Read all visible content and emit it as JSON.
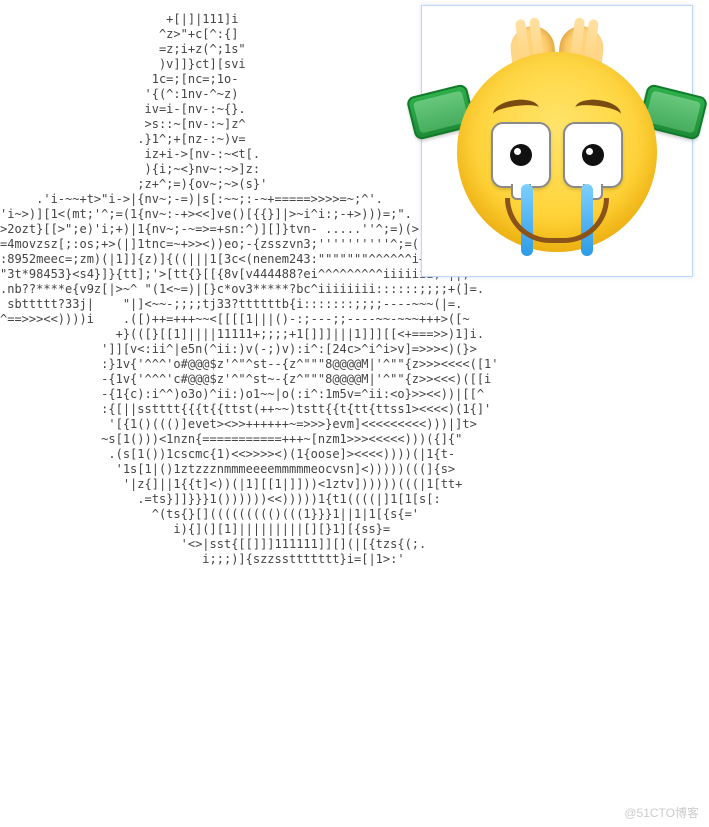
{
  "watermark": "@51CTO博客",
  "emoji": "praying-crying-face",
  "ascii": [
    "                       +[|]|111]i",
    "                      ^z>\"+c[^:{]",
    "                      =z;i+z(^;1s\"",
    "                      )v]]}ct][svi",
    "                     1c=;[nc=;1o-",
    "                    '{(^:1nv-^~z)",
    "                    iv=i-[nv-:~{}.",
    "                    >s::~[nv-:~]z^",
    "                   .}1^;+[nz-:~)v=",
    "                    iz+i->[nv-:~<t[.",
    "                    ){i;~<}nv~:~>]z:",
    "                   ;z+^;=){ov~;~>(s}'",
    "     .'i-~~+t>\"i->|{nv~;-=)|s[:~~;:-~+=====>>>>=~;^'.",
    "'i~>)][1<(mt;'^;=(1{nv~:-+><<]ve()[{{}]|>~i^i:;-+>)))=;\".",
    ">2ozt}[[>\";e)'i;+)|1{nv~;-~=>=+sn:^)][]}tvn- .....''^;=)(>;'",
    "=4movzsz[;:os;+>(|]1tnc=~+>><))eo;-{zsszvn3;''''''''''^;=((+^",
    ":8952meec=;zm)(|1]]{z)]{((|||1[3c<(nenem243:\"\"\"\"\"\"\"^^^^^^i+(|=\"",
    "\"3t*98453}<s4}]}{tt];'>[tt{}[[{8v[v444488?ei^^^^^^^^^iiiiiii;>||;",
    ".nb??****e{v9z[|>~^ \"(1<~=)|[}c*ov3*****?bc^iiiiiiii::::::;;;;+(]=.",
    " sbttttt?33j|    \"|]<~~-;;;;tj33?ttttttb{i:::::::;;;;----~~~(|=.",
    "^==>>><<))))i    .([)++=+++~~<[[[[1|||()-:;---;;----~~-~~~+++>([~",
    "                +}(([}[[1]||||11111+;;;;+1[]]]|||1]]][[<+===>>)1]i.",
    "              ']][v<:ii^|e5n(^ii:)v(-;)v):i^:[24c>^i^i>v]=>>><)(}>",
    "              :}1v{'^^^'o#@@@$z'^\"^st--{z^\"\"\"8@@@@M|'^\"\"{z>>><<<<([1'",
    "              -{1v{'^^^'c#@@@$z'^\"^st~-{z^\"\"\"8@@@@M|'^\"\"{z>><<<)([[i",
    "              -{1{c):i^^)o3o)^ii:)o1~~|o(:i^:1m5v=^ii:<o}>><<))|[[^",
    "              :{[||sstttt{{{t{{ttst(++~~)tstt{{t{tt{ttss1><<<<)(1{]'",
    "               '[{1()((()]evet><>>++++++~=>>>}evm]<<<<<<<<<)))|]t>",
    "              ~s[1()))<1nzn{===========+++~[nzm1>>><<<<<)))({]{\"",
    "               .(s[1())1cscmc{1)<<>>>><)(1{oose]><<<<))))(|1{t-",
    "                '1s[1|()1ztzzznmmmeeeemmmmmeocvsn]<)))))(((]{s>",
    "                 '|z{]||1{{t]<))(|1][[1|]]))<1ztv])))))(((|1[tt+",
    "                   .=ts}]]}}}1())))))<<)))))1{t1((((|]1[1[s[:",
    "                     ^(ts{}[]((((((((()(((1}}}1||1|1[{s{='",
    "                        i){](][1]|||||||||[][}1][{ss}=",
    "                         '<>|sst{[[]]]111111]][](|[{tzs{(;.",
    "                            i;;;)]{szzssttttttt}i=[|1>:'"
  ]
}
